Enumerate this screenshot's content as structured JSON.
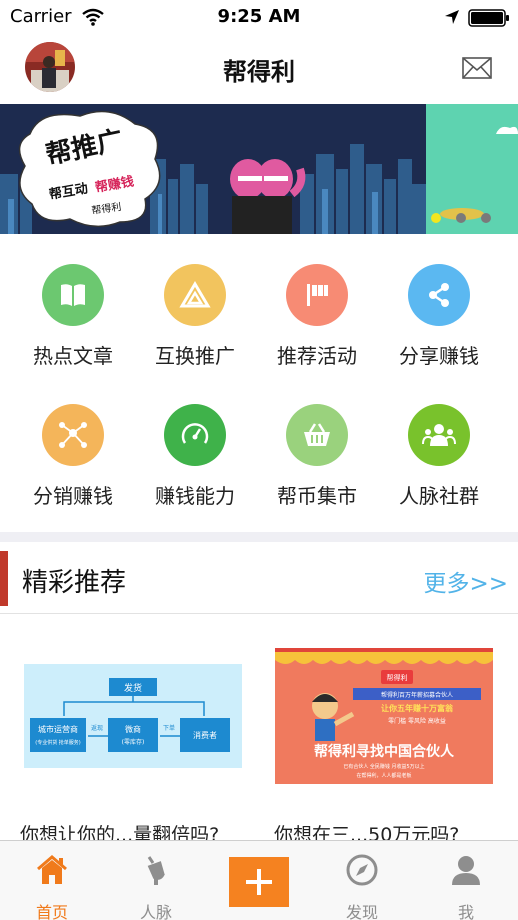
{
  "status_bar": {
    "carrier": "Carrier",
    "time": "9:25 AM"
  },
  "nav": {
    "title": "帮得利",
    "avatar_icon": "avatar-photo",
    "mail_icon": "mail-icon"
  },
  "banner": {
    "main_text": "帮推广",
    "sub_text_1": "帮互动",
    "sub_text_2": "帮赚钱",
    "brand_text": "帮得利",
    "dot_count": 3,
    "active_dot": 0
  },
  "grid": {
    "items": [
      {
        "label": "热点文章",
        "icon": "book-icon",
        "color": "#6cc870"
      },
      {
        "label": "互换推广",
        "icon": "triangle-exchange-icon",
        "color": "#f2c45e"
      },
      {
        "label": "推荐活动",
        "icon": "flag-icon",
        "color": "#f78b74"
      },
      {
        "label": "分享赚钱",
        "icon": "share-icon",
        "color": "#5bb8f1"
      },
      {
        "label": "分销赚钱",
        "icon": "network-icon",
        "color": "#f4b55a"
      },
      {
        "label": "赚钱能力",
        "icon": "gauge-icon",
        "color": "#3fb24a"
      },
      {
        "label": "帮币集市",
        "icon": "basket-icon",
        "color": "#9ad27d"
      },
      {
        "label": "人脉社群",
        "icon": "people-icon",
        "color": "#79c22c"
      }
    ]
  },
  "section": {
    "title": "精彩推荐",
    "more": "更多>>"
  },
  "cards": [
    {
      "title": "你想让你的...量翻倍吗?",
      "diagram": {
        "top": "发货",
        "left": "城市运营商",
        "left_sub": "(专业供货 抢单服务)",
        "middle": "微商",
        "middle_sub": "(零库存)",
        "right": "消费者",
        "arrow_left": "返现",
        "arrow_right": "下单"
      }
    },
    {
      "title": "你想在三...50万元吗?",
      "poster": {
        "badge": "帮得利",
        "line1": "帮得利百万年薪招募合伙人",
        "line2": "让你五年赚十万富翁",
        "line3": "零门槛 零风险 高收益",
        "line4": "帮得利寻找中国合伙人",
        "line5": "已有合伙人 全民赚钱 月收益5万以上",
        "line6": "在帮得利，人人都是老板"
      }
    }
  ],
  "tabs": [
    {
      "label": "首页",
      "icon": "home-icon",
      "active": true
    },
    {
      "label": "人脉",
      "icon": "cocktail-icon",
      "active": false
    },
    {
      "label": "",
      "icon": "plus-icon",
      "active": false
    },
    {
      "label": "发现",
      "icon": "compass-icon",
      "active": false
    },
    {
      "label": "我",
      "icon": "person-icon",
      "active": false
    }
  ],
  "colors": {
    "accent": "#f58220",
    "active_tab": "#f07a1b",
    "section_bar": "#c0392b",
    "more_link": "#52b3e8"
  }
}
